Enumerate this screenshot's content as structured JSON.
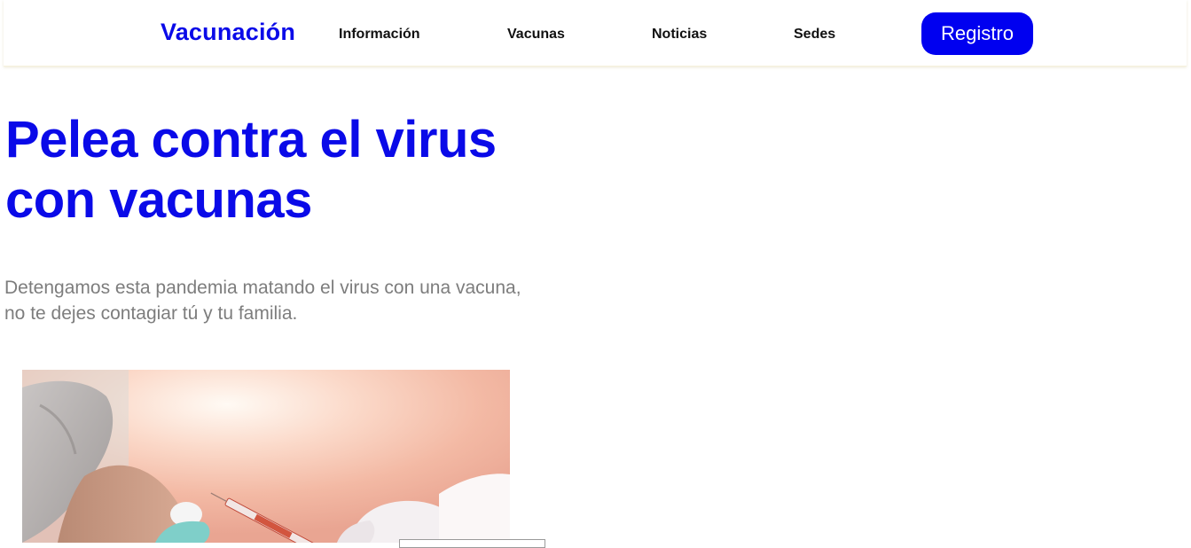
{
  "header": {
    "brand": "Vacunación",
    "nav": [
      {
        "label": "Información"
      },
      {
        "label": "Vacunas"
      },
      {
        "label": "Noticias"
      },
      {
        "label": "Sedes"
      }
    ],
    "register_label": "Registro"
  },
  "hero": {
    "title_lines": [
      "Pelea contra el virus",
      "con vacunas"
    ],
    "text_lines": [
      "Detengamos esta pandemia matando el virus con una vacuna,",
      "no te dejes contagiar tú y tu familia."
    ]
  },
  "colors": {
    "accent": "#0a0ae8",
    "button": "#0000f0",
    "body_text": "#7d7d7d"
  }
}
